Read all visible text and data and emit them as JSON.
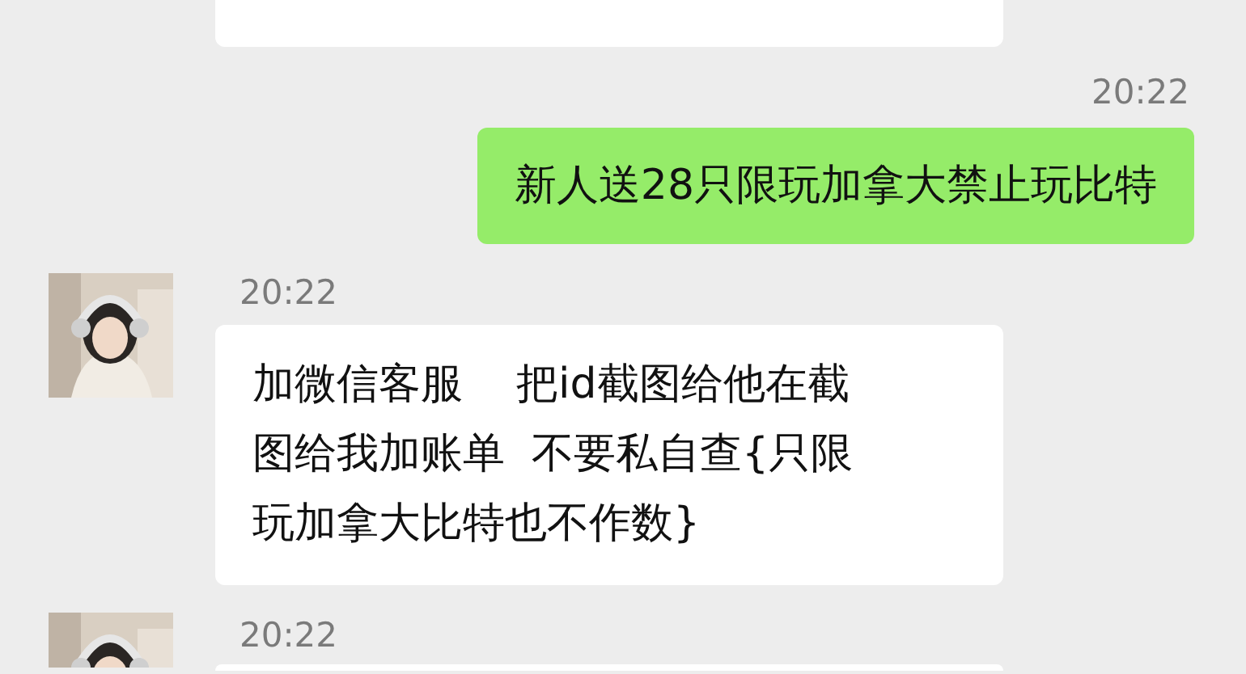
{
  "messages": [
    {
      "kind": "cut_bubble",
      "outgoing": false
    },
    {
      "kind": "time",
      "text": "20:22"
    },
    {
      "kind": "bubble",
      "outgoing": true,
      "text": "新人送28只限玩加拿大禁止玩比特"
    },
    {
      "kind": "incoming",
      "time": "20:22",
      "text": "加微信客服    把id截图给他在截图给我加账单  不要私自查{只限玩加拿大比特也不作数}"
    },
    {
      "kind": "incoming_cut",
      "time": "20:22"
    }
  ]
}
